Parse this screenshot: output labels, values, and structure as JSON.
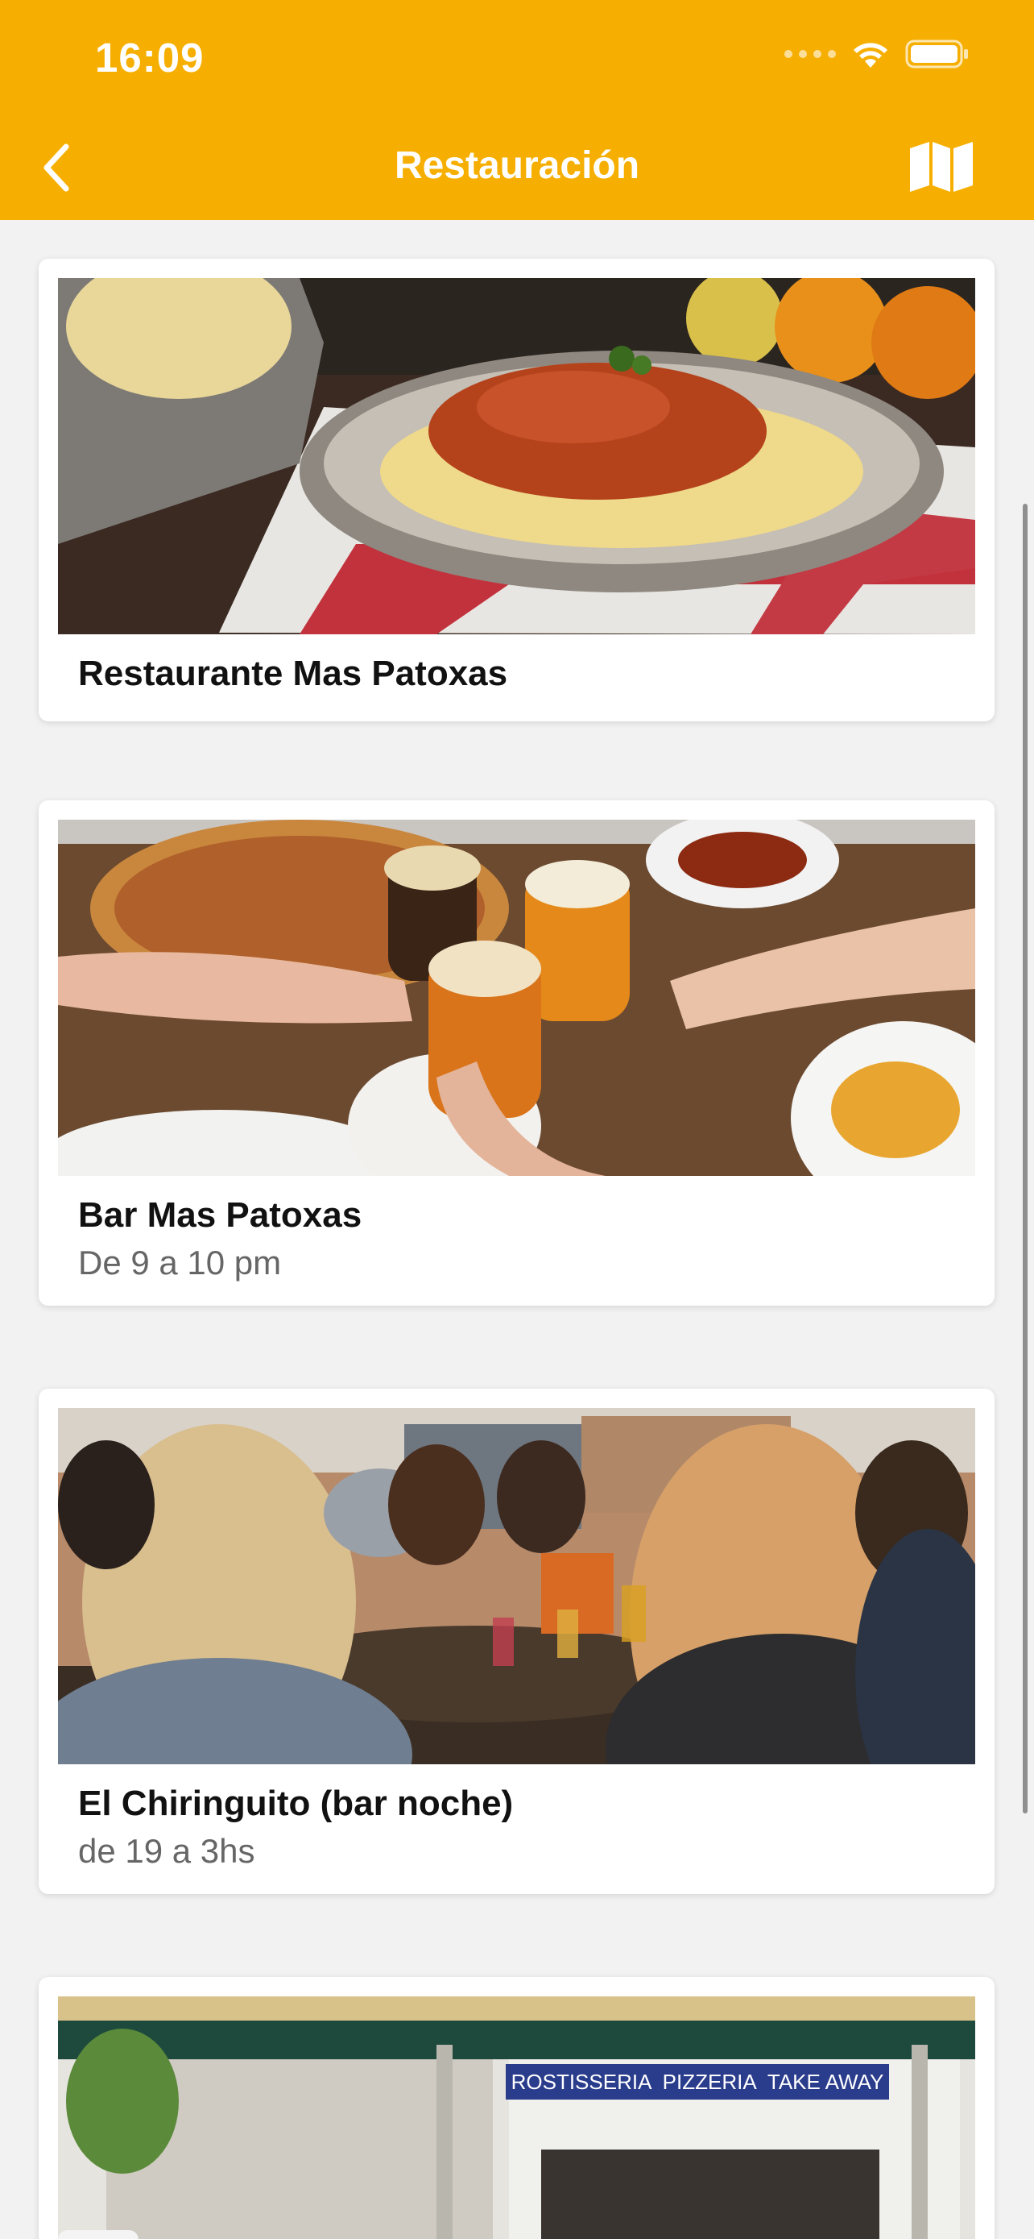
{
  "status_bar": {
    "time": "16:09"
  },
  "nav": {
    "title": "Restauración",
    "back_icon": "chevron-left-icon",
    "map_icon": "map-icon",
    "colors": {
      "bar": "#f6af00",
      "foreground": "#ffffff"
    }
  },
  "restaurants": [
    {
      "name": "Restaurante Mas Patoxas",
      "hours": "",
      "image": "spaghetti-bolognese-photo"
    },
    {
      "name": "Bar Mas Patoxas",
      "hours": "De 9 a 10 pm",
      "image": "beer-toast-pizza-photo"
    },
    {
      "name": "El Chiringuito (bar noche)",
      "hours": "de 19 a 3hs",
      "image": "group-dinner-photo"
    },
    {
      "name": "",
      "hours": "",
      "image": "storefront-photo",
      "sign": [
        "ROSTISSERIA",
        "PIZZERIA",
        "TAKE AWAY"
      ]
    }
  ]
}
